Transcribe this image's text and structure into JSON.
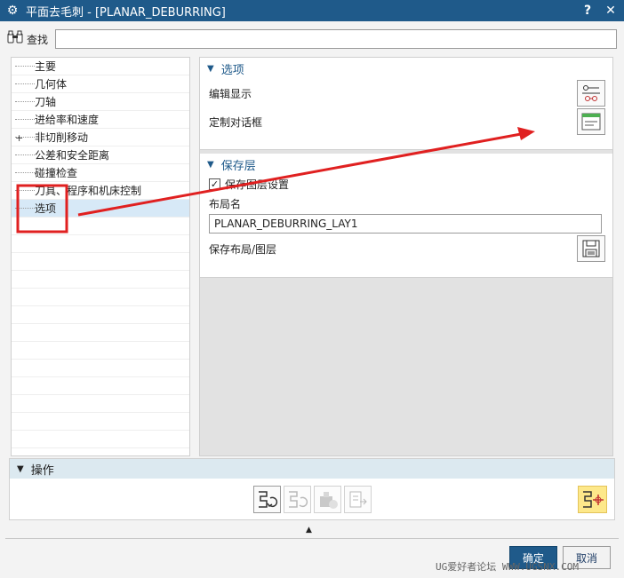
{
  "window": {
    "title": "平面去毛刺 - [PLANAR_DEBURRING]",
    "help": "?",
    "close": "✕"
  },
  "find": {
    "label": "查找",
    "value": ""
  },
  "tree": {
    "items": [
      {
        "label": "主要"
      },
      {
        "label": "几何体"
      },
      {
        "label": "刀轴"
      },
      {
        "label": "进给率和速度"
      },
      {
        "label": "非切削移动",
        "expander": "+"
      },
      {
        "label": "公差和安全距离"
      },
      {
        "label": "碰撞检查"
      },
      {
        "label": "刀具、程序和机床控制"
      },
      {
        "label": "选项",
        "selected": true
      }
    ]
  },
  "options_group": {
    "title": "选项",
    "edit_display_label": "编辑显示",
    "custom_dialog_label": "定制对话框"
  },
  "save_layer_group": {
    "title": "保存层",
    "save_layer_settings_label": "保存图层设置",
    "save_layer_settings_checked": true,
    "layout_name_label": "布局名",
    "layout_name_value": "PLANAR_DEBURRING_LAY1",
    "save_layout_label": "保存布局/图层"
  },
  "operations": {
    "title": "操作"
  },
  "footer": {
    "ok_label": "确定",
    "cancel_label": "取消"
  },
  "watermark": "UG爱好者论坛 WWW.UGSNX.COM",
  "annotation_color": "#e02020",
  "accent_color": "#1f5a8a"
}
